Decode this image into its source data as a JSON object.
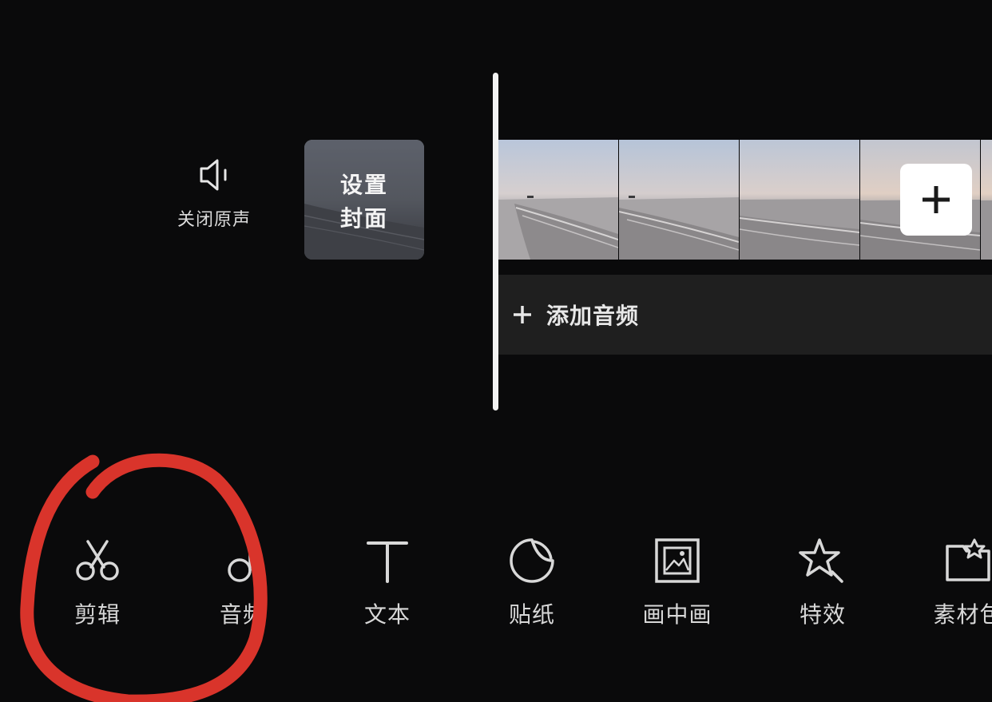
{
  "mute": {
    "label": "关闭原声",
    "icon": "speaker-icon"
  },
  "cover": {
    "line1": "设置",
    "line2": "封面"
  },
  "timeline": {
    "frame_count": 5,
    "add_clip_icon": "plus-icon"
  },
  "audio": {
    "label": "添加音频",
    "icon": "plus-icon"
  },
  "toolbar": {
    "items": [
      {
        "label": "剪辑",
        "icon": "scissors-icon"
      },
      {
        "label": "音频",
        "icon": "music-note-icon"
      },
      {
        "label": "文本",
        "icon": "text-icon"
      },
      {
        "label": "贴纸",
        "icon": "sticker-icon"
      },
      {
        "label": "画中画",
        "icon": "picture-in-picture-icon"
      },
      {
        "label": "特效",
        "icon": "effects-star-icon"
      },
      {
        "label": "素材包",
        "icon": "material-pack-icon"
      }
    ]
  },
  "colors": {
    "background": "#0a0a0b",
    "audio_track": "#1f1f1f",
    "annotation": "#d9342b",
    "playhead": "#f2f2f2"
  }
}
